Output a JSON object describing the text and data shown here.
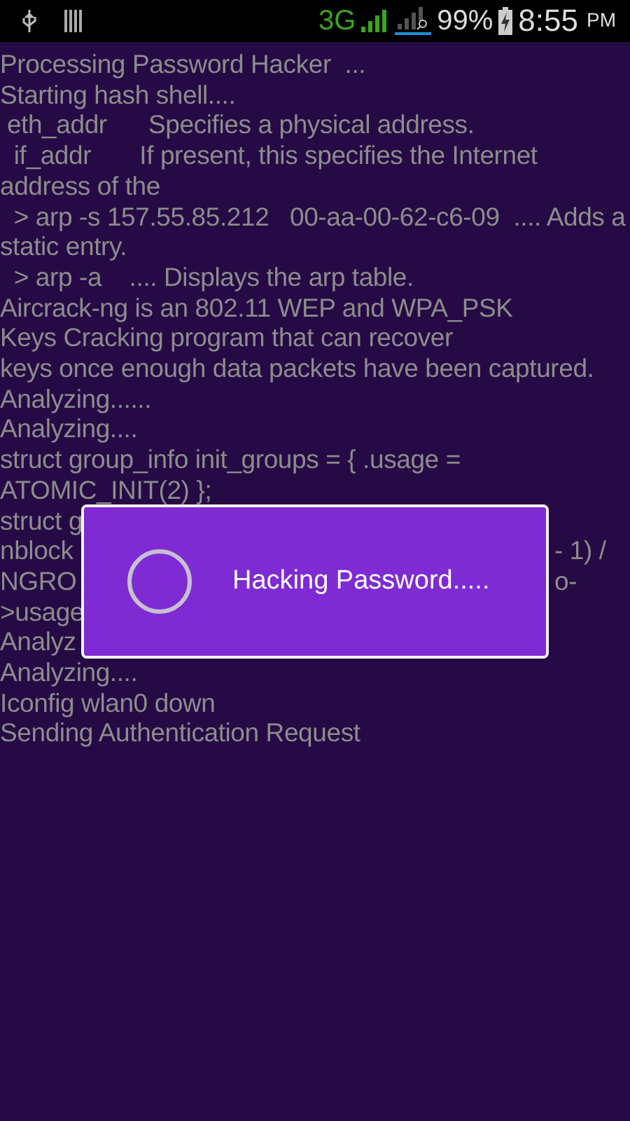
{
  "status_bar": {
    "network": "3G",
    "battery": "99%",
    "time": "8:55",
    "ampm": "PM"
  },
  "log": [
    {
      "text": "Processing Password Hacker  ..."
    },
    {
      "text": "Starting hash shell...."
    },
    {
      "text": " eth_addr      Specifies a physical address."
    },
    {
      "text": "  if_addr       If present, this specifies the Internet"
    },
    {
      "text": "address of the"
    },
    {
      "text": "  > arp -s 157.55.85.212   00-aa-00-62-c6-09  .... Adds a"
    },
    {
      "text": "static entry."
    },
    {
      "text": "  > arp -a    .... Displays the arp table."
    },
    {
      "text": "Aircrack-ng is an 802.11 WEP and WPA_PSK"
    },
    {
      "text": "Keys Cracking program that can recover"
    },
    {
      "text": "keys once enough data packets have been captured."
    },
    {
      "text": "Analyzing......"
    },
    {
      "text": "Analyzing...."
    },
    {
      "text": "struct group_info init_groups = { .usage ="
    },
    {
      "text": "ATOMIC_INIT(2) };"
    },
    {
      "text": "struct g"
    },
    {
      "text": "nblock",
      "right": "- 1) /"
    },
    {
      "text": "NGRO",
      "right": "o-"
    },
    {
      "text": ">usage"
    },
    {
      "text": "Analyz"
    },
    {
      "text": "Analyzing...."
    },
    {
      "text": "Iconfig wlan0 down"
    },
    {
      "text": "Sending Authentication Request"
    }
  ],
  "dialog": {
    "message": "Hacking Password....."
  }
}
